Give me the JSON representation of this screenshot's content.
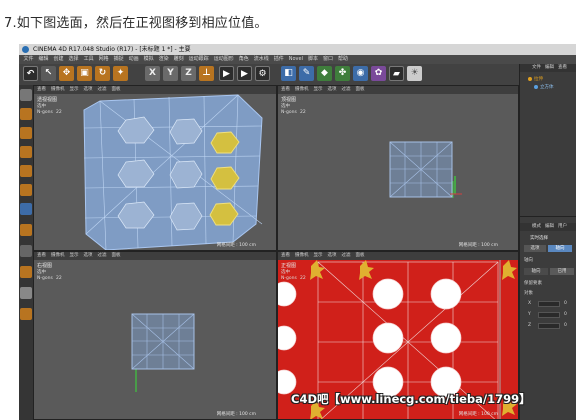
{
  "caption": "7.如下图选面，然后在正视图移到相应位值。",
  "window": {
    "title": "CINEMA 4D R17.048 Studio (R17) - [未标题 1 *] - 主要"
  },
  "menubar": [
    "文件",
    "编辑",
    "创建",
    "选择",
    "工具",
    "网格",
    "捕捉",
    "动画",
    "模拟",
    "渲染",
    "雕刻",
    "运动跟踪",
    "运动图形",
    "角色",
    "流水线",
    "插件",
    "Novel",
    "脚本",
    "窗口",
    "帮助"
  ],
  "toolbar": {
    "axis_x": "X",
    "axis_y": "Y",
    "axis_z": "Z",
    "icons": [
      "undo-icon",
      "select-icon",
      "move-icon",
      "scale-icon",
      "rotate-icon",
      "recent-icon",
      "axis-x-icon",
      "axis-y-icon",
      "axis-z-icon",
      "coord-icon",
      "render-view-icon",
      "render-icon",
      "render-settings-icon",
      "cube-icon",
      "pen-icon",
      "subdivide-icon",
      "array-icon",
      "deformer-icon",
      "scene-icon",
      "camera-icon",
      "light-icon"
    ]
  },
  "viewport_menu": [
    "查看",
    "摄像机",
    "显示",
    "选项",
    "过滤",
    "面板"
  ],
  "viewports": [
    {
      "name": "透视视图",
      "stats_label": "选中",
      "ngons_label": "N-gons",
      "ngons_value": "22",
      "grid": "网格间距 : 100 cm"
    },
    {
      "name": "顶视图",
      "stats_label": "选中",
      "ngons_label": "N-gons",
      "ngons_value": "22",
      "grid": "网格间距 : 100 cm"
    },
    {
      "name": "右视图",
      "stats_label": "选中",
      "ngons_label": "N-gons",
      "ngons_value": "22",
      "grid": "网格间距 : 100 cm"
    },
    {
      "name": "正视图",
      "stats_label": "选中",
      "ngons_label": "N-gons",
      "ngons_value": "22",
      "grid": "网格间距 : 100 cm"
    }
  ],
  "object_manager": {
    "menu": [
      "文件",
      "编辑",
      "查看"
    ],
    "objects": [
      {
        "label": "拉伸",
        "color": "#e0a020"
      },
      {
        "label": "立方体",
        "color": "#5aa0e0"
      }
    ]
  },
  "attribute_manager": {
    "menu": [
      "模式",
      "编辑",
      "用户"
    ],
    "header": "实时选择",
    "tabs": [
      "选项",
      "轴向"
    ],
    "section": "轴向",
    "sub_tabs": [
      "轴向",
      "已用"
    ],
    "option": "保留要素",
    "row_label": "对象",
    "coords": [
      {
        "axis": "X",
        "value": "0"
      },
      {
        "axis": "Y",
        "value": "0"
      },
      {
        "axis": "Z",
        "value": "0"
      }
    ]
  },
  "colors": {
    "app_bg": "#3a3a3a",
    "viewport_bg": "#5a5a5a",
    "front_view_bg": "#d0201a",
    "mesh_blue": "#7aa6d8",
    "selected_yellow": "#d4c040"
  },
  "watermark": "C4D吧【www.linecg.com/tieba/1799】"
}
